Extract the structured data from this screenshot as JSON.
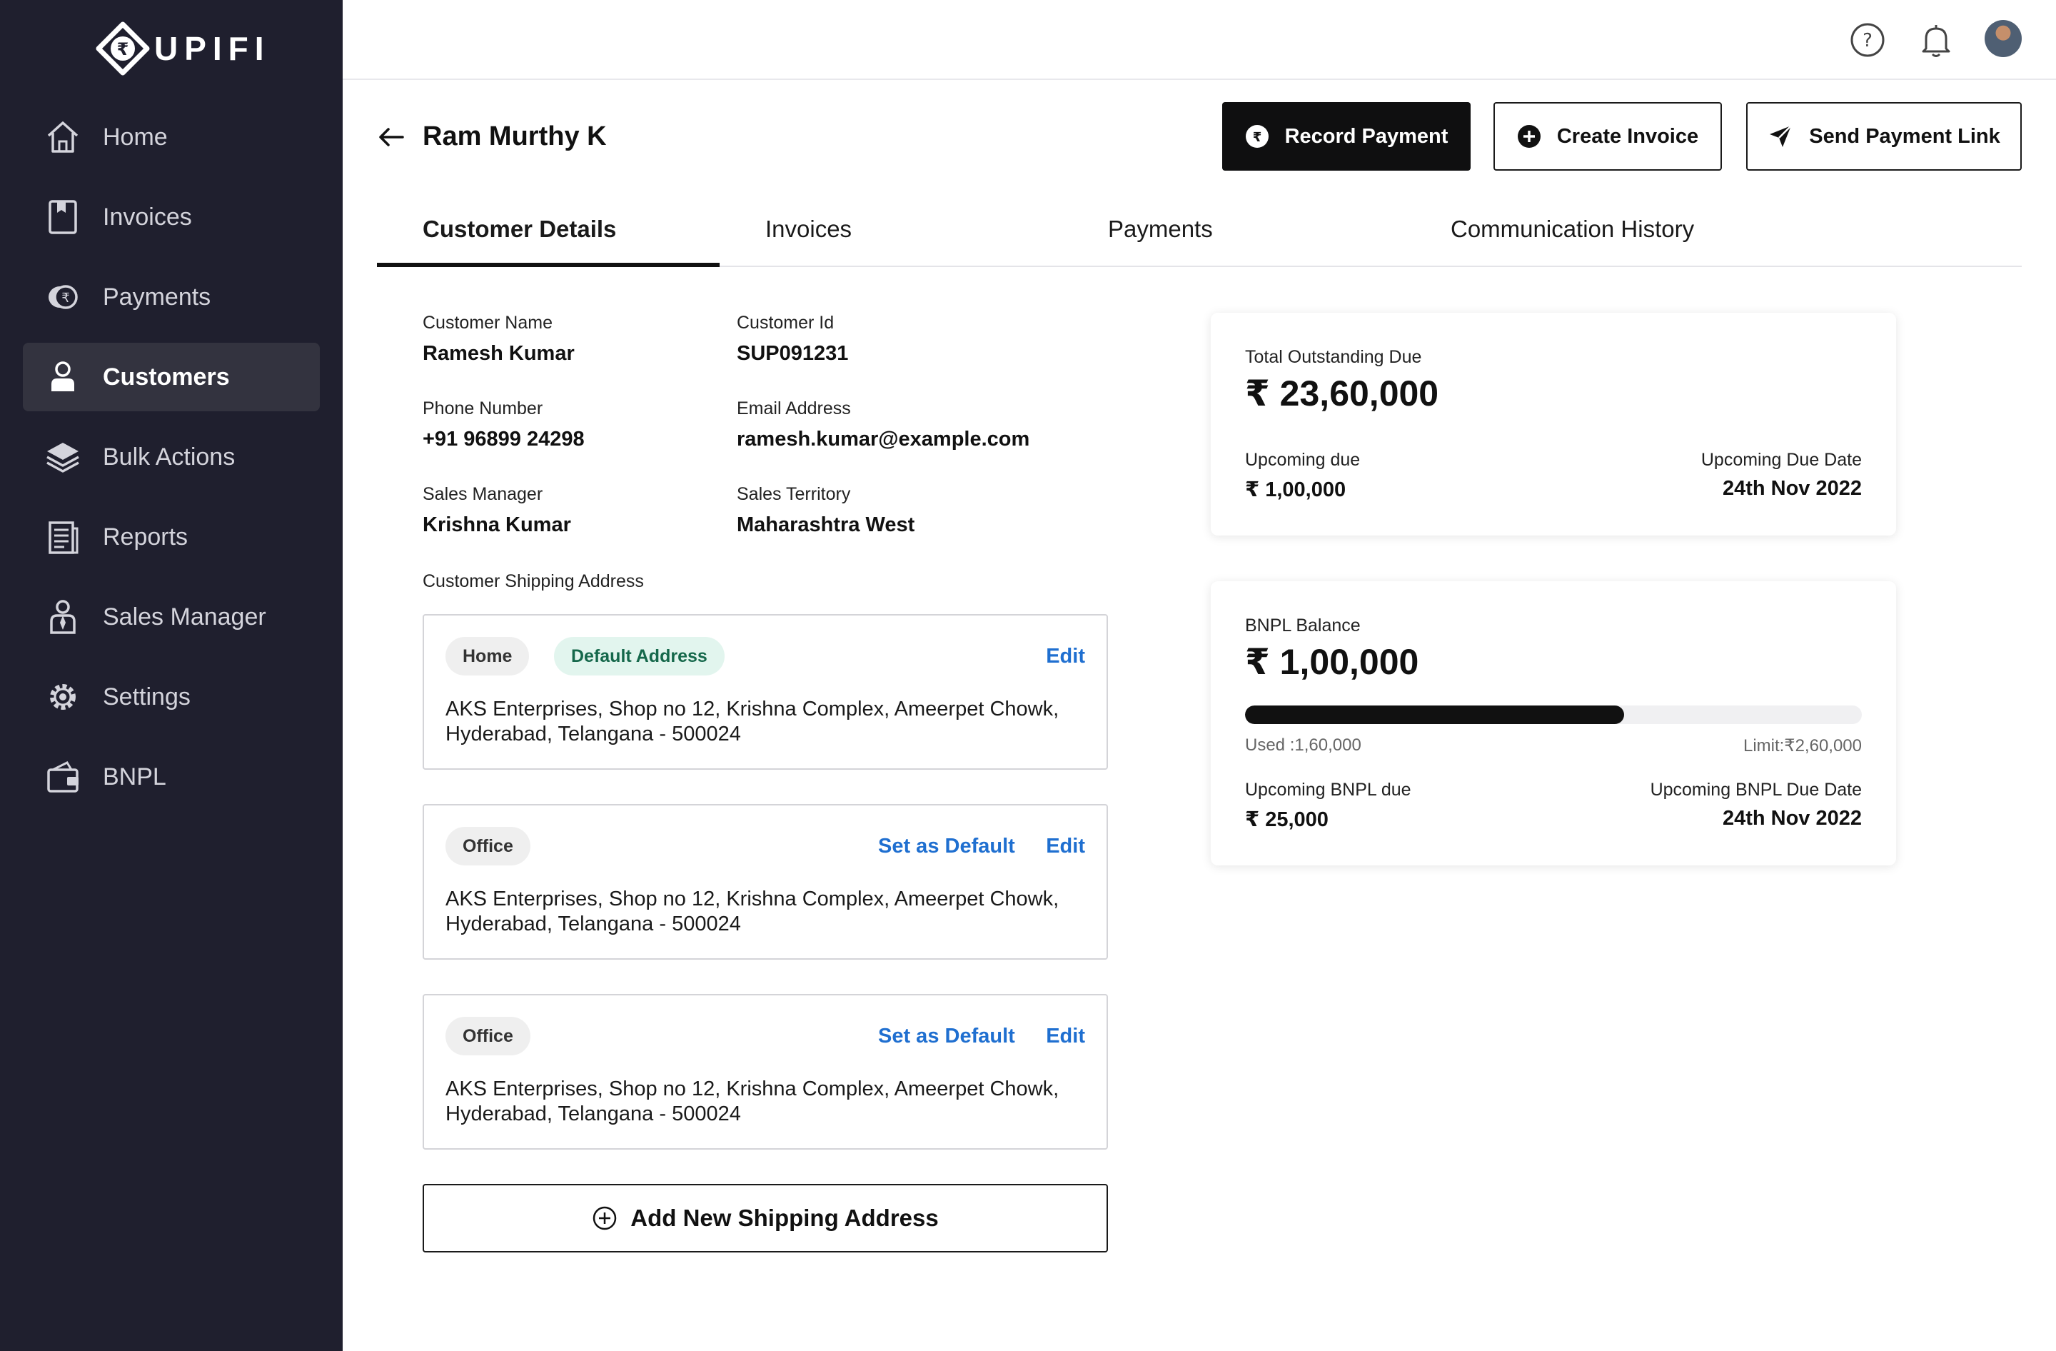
{
  "app": {
    "brand": "UPIFI"
  },
  "sidebar": {
    "items": [
      {
        "label": "Home",
        "icon": "home-icon"
      },
      {
        "label": "Invoices",
        "icon": "invoice-icon"
      },
      {
        "label": "Payments",
        "icon": "rupee-coin-icon"
      },
      {
        "label": "Customers",
        "icon": "user-icon",
        "active": true
      },
      {
        "label": "Bulk Actions",
        "icon": "layers-icon"
      },
      {
        "label": "Reports",
        "icon": "report-icon"
      },
      {
        "label": "Sales Manager",
        "icon": "manager-icon"
      },
      {
        "label": "Settings",
        "icon": "gear-icon"
      },
      {
        "label": "BNPL",
        "icon": "wallet-icon"
      }
    ]
  },
  "header": {
    "title": "Ram Murthy K",
    "record_payment": "Record Payment",
    "create_invoice": "Create Invoice",
    "send_payment_link": "Send Payment Link"
  },
  "tabs": [
    {
      "label": "Customer Details",
      "active": true
    },
    {
      "label": "Invoices"
    },
    {
      "label": "Payments"
    },
    {
      "label": "Communication History"
    }
  ],
  "details": {
    "customer_name_label": "Customer Name",
    "customer_name": "Ramesh Kumar",
    "customer_id_label": "Customer Id",
    "customer_id": "SUP091231",
    "phone_label": "Phone Number",
    "phone": "+91 96899 24298",
    "email_label": "Email Address",
    "email": "ramesh.kumar@example.com",
    "sales_manager_label": "Sales Manager",
    "sales_manager": "Krishna Kumar",
    "sales_territory_label": "Sales Territory",
    "sales_territory": "Maharashtra West"
  },
  "shipping": {
    "section_label": "Customer Shipping Address",
    "addresses": [
      {
        "type": "Home",
        "default_badge": "Default Address",
        "edit": "Edit",
        "line1": "AKS Enterprises, Shop no 12, Krishna Complex, Ameerpet Chowk,",
        "line2": "Hyderabad, Telangana - 500024"
      },
      {
        "type": "Office",
        "set_default": "Set as Default",
        "edit": "Edit",
        "line1": "AKS Enterprises, Shop no 12, Krishna Complex, Ameerpet Chowk,",
        "line2": "Hyderabad, Telangana - 500024"
      },
      {
        "type": "Office",
        "set_default": "Set as Default",
        "edit": "Edit",
        "line1": "AKS Enterprises, Shop no 12, Krishna Complex, Ameerpet Chowk,",
        "line2": "Hyderabad, Telangana - 500024"
      }
    ],
    "add_button": "Add New Shipping Address"
  },
  "outstanding": {
    "label": "Total Outstanding Due",
    "amount": "₹ 23,60,000",
    "upcoming_due_label": "Upcoming due",
    "upcoming_due": "₹ 1,00,000",
    "upcoming_due_date_label": "Upcoming Due Date",
    "upcoming_due_date": "24th Nov 2022"
  },
  "bnpl": {
    "label": "BNPL Balance",
    "amount": "₹ 1,00,000",
    "used": "Used :1,60,000",
    "limit": "Limit:₹2,60,000",
    "used_fraction": 0.615,
    "upcoming_due_label": "Upcoming BNPL due",
    "upcoming_due": "₹ 25,000",
    "upcoming_due_date_label": "Upcoming BNPL Due Date",
    "upcoming_due_date": "24th Nov 2022"
  },
  "colors": {
    "sidebar_bg": "#1f1f2e",
    "accent_link": "#1f6fd0",
    "default_badge_bg": "#e2f5ee",
    "primary_button": "#0f0f10"
  }
}
